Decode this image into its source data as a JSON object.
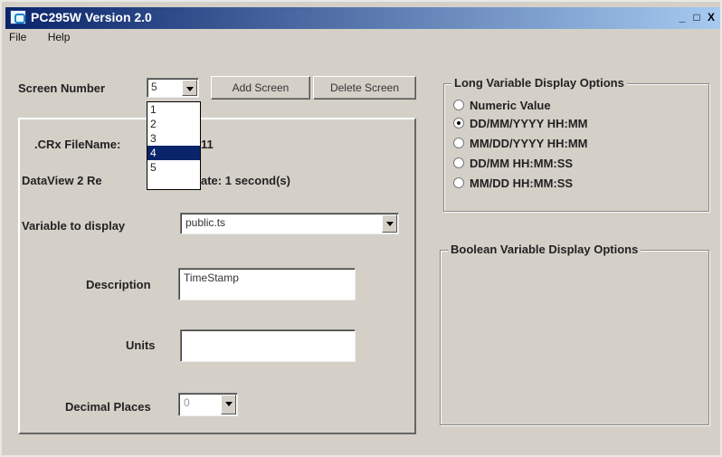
{
  "window": {
    "title": "PC295W Version 2.0",
    "controls": {
      "minimize": "_",
      "maximize": "□",
      "close": "X"
    }
  },
  "menu": [
    "File",
    "Help"
  ],
  "screen": {
    "label": "Screen Number",
    "value": "5",
    "options": [
      "1",
      "2",
      "3",
      "4",
      "5"
    ],
    "highlighted": "4",
    "add_label": "Add Screen",
    "delete_label": "Delete Screen"
  },
  "left_panel": {
    "crx_label": ".CRx FileName:",
    "crx_value": "11",
    "dataview_label": "DataView 2 Re",
    "dataview_value": "ate: 1 second(s)",
    "variable_label": "Variable to display",
    "variable_value": "public.ts",
    "description_label": "Description",
    "description_value": "TimeStamp",
    "units_label": "Units",
    "units_value": "",
    "decimal_label": "Decimal Places",
    "decimal_value": "0"
  },
  "long_options": {
    "title": "Long Variable Display Options",
    "options": [
      "Numeric Value",
      "DD/MM/YYYY HH:MM",
      "MM/DD/YYYY HH:MM",
      "DD/MM HH:MM:SS",
      "MM/DD HH:MM:SS"
    ],
    "selected_index": 1
  },
  "boolean_options": {
    "title": "Boolean Variable Display Options"
  },
  "colors": {
    "titlebar_start": "#0a246a",
    "titlebar_end": "#a6caf0",
    "face": "#d4d0c8",
    "selection": "#0a246a"
  },
  "icons": {
    "app": "pc-app-icon",
    "dropdown": "chevron-down-icon"
  }
}
